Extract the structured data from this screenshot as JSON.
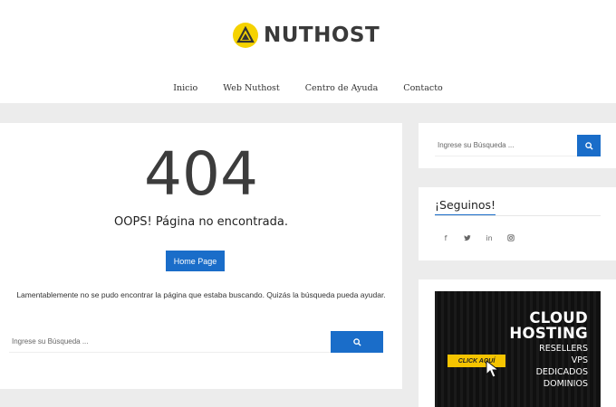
{
  "brand": {
    "name": "NUTHOST",
    "accent": "#f5d200"
  },
  "nav": {
    "items": [
      "Inicio",
      "Web Nuthost",
      "Centro de Ayuda",
      "Contacto"
    ]
  },
  "error": {
    "code": "404",
    "message": "OOPS! Página no encontrada.",
    "home_button": "Home Page",
    "apology": "Lamentablemente no se pudo encontrar la página que estaba buscando. Quizás la búsqueda pueda ayudar."
  },
  "search": {
    "placeholder": "Ingrese su Búsqueda ...",
    "button_icon": "search-icon"
  },
  "sidebar": {
    "search_placeholder": "Ingrese su Búsqueda ...",
    "follow_title": "¡Seguinos!",
    "socials": [
      {
        "icon": "facebook-icon",
        "glyph": "f"
      },
      {
        "icon": "twitter-icon",
        "glyph": "🐦"
      },
      {
        "icon": "linkedin-icon",
        "glyph": "in"
      },
      {
        "icon": "instagram-icon",
        "glyph": "◻"
      }
    ],
    "banner": {
      "title1": "CLOUD",
      "title2": "HOSTING",
      "cta": "CLICK AQUÍ",
      "items": [
        "RESELLERS",
        "VPS",
        "DEDICADOS",
        "DOMINIOS"
      ]
    }
  },
  "colors": {
    "primary": "#1a6dc9",
    "background": "#ececec"
  }
}
